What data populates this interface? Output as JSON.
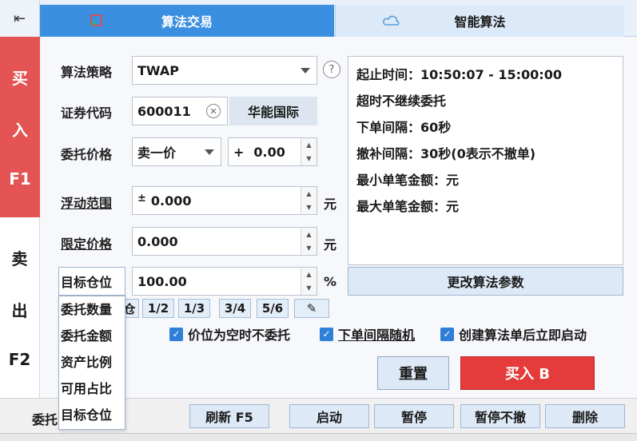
{
  "tabs": {
    "algo_trade": "算法交易",
    "smart_algo": "智能算法"
  },
  "side": {
    "buy": [
      "买",
      "入",
      "F1"
    ],
    "sell": [
      "卖",
      "出",
      "F2"
    ]
  },
  "form": {
    "strategy_label": "算法策略",
    "strategy_value": "TWAP",
    "code_label": "证券代码",
    "code_value": "600011",
    "stock_name": "华能国际",
    "price_label": "委托价格",
    "price_type": "卖一价",
    "price_sign": "+",
    "price_offset": "0.00",
    "float_label": "浮动范围",
    "float_sign": "±",
    "float_value": "0.000",
    "float_unit": "元",
    "limit_label": "限定价格",
    "limit_value": "0.000",
    "limit_unit": "元",
    "target_label": "目标仓位",
    "target_value": "100.00",
    "target_unit": "%"
  },
  "info": [
    "起止时间：10:50:07 - 15:00:00",
    "超时不继续委托",
    "下单间隔：60秒",
    "撤补间隔：30秒(0表示不撤单)",
    "最小单笔金额：元",
    "最大单笔金额：元"
  ],
  "change_params": "更改算法参数",
  "ratios": [
    "仓",
    "1/2",
    "1/3",
    "3/4",
    "5/6"
  ],
  "checks": [
    "价位为空时不委托",
    "下单间隔随机",
    "创建算法单后立即启动"
  ],
  "buttons": {
    "reset": "重置",
    "buy": "买入 B"
  },
  "popup": [
    "委托数量",
    "委托金额",
    "资产比例",
    "可用占比",
    "目标仓位"
  ],
  "toolbar": {
    "left_label": "委托",
    "refresh": "刷新 F5",
    "start": "启动",
    "pause": "暂停",
    "pause_no_cancel": "暂停不撤",
    "delete": "删除"
  },
  "colors": {
    "accent": "#3b8fe0",
    "buy": "#e53b3b"
  }
}
